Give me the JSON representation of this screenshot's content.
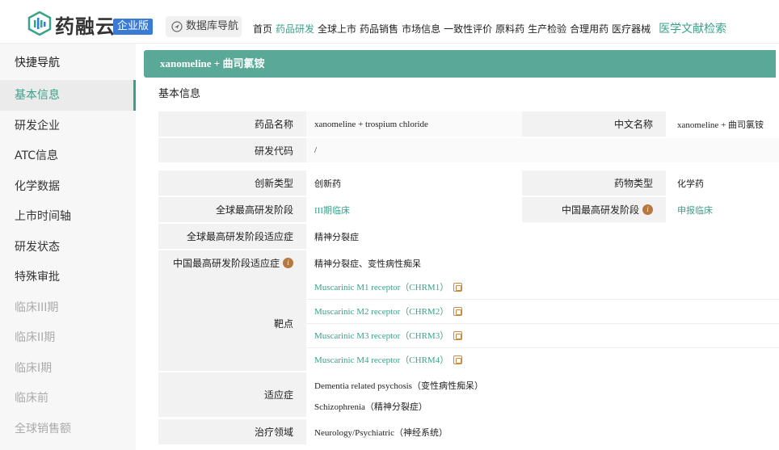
{
  "header": {
    "brand": "药融云",
    "edition": "企业版",
    "db_nav": "数据库导航",
    "nav": [
      "首页",
      "药品研发",
      "全球上市",
      "药品销售",
      "市场信息",
      "一致性评价",
      "原料药",
      "生产检验",
      "合理用药",
      "医疗器械"
    ],
    "nav_active": "药品研发",
    "nav_highlight": "医学文献检索"
  },
  "sidebar": {
    "title": "快捷导航",
    "items": [
      "基本信息",
      "研发企业",
      "ATC信息",
      "化学数据",
      "上市时间轴",
      "研发状态",
      "特殊审批",
      "临床III期",
      "临床II期",
      "临床I期",
      "临床前",
      "全球销售额"
    ],
    "active": "基本信息"
  },
  "page": {
    "title": "xanomeline + 曲司氯铵",
    "section": "基本信息",
    "fields": {
      "drug_name_label": "药品名称",
      "drug_name": "xanomeline + trospium chloride",
      "cn_name_label": "中文名称",
      "cn_name": "xanomeline + 曲司氯铵",
      "code_label": "研发代码",
      "code": "/",
      "innov_label": "创新类型",
      "innov": "创新药",
      "type_label": "药物类型",
      "type": "化学药",
      "global_stage_label": "全球最高研发阶段",
      "global_stage": "III期临床",
      "cn_stage_label": "中国最高研发阶段",
      "cn_stage": "申报临床",
      "global_ind_label": "全球最高研发阶段适应症",
      "global_ind": "精神分裂症",
      "cn_ind_label": "中国最高研发阶段适应症",
      "cn_ind": "精神分裂症、变性病性痴呆",
      "target_label": "靶点",
      "targets": [
        "Muscarinic M1 receptor（CHRM1）",
        "Muscarinic M2 receptor（CHRM2）",
        "Muscarinic M3 receptor（CHRM3）",
        "Muscarinic M4 receptor（CHRM4）"
      ],
      "indication_label": "适应症",
      "indications": [
        "Dementia related psychosis（变性病性痴呆）",
        "Schizophrenia（精神分裂症）"
      ],
      "area_label": "治疗领域",
      "area": "Neurology/Psychiatric（神经系统）"
    }
  },
  "colors": {
    "accent": "#3aa18a",
    "title_bar": "#5aa898",
    "edition_bg": "#3a7bd5"
  }
}
